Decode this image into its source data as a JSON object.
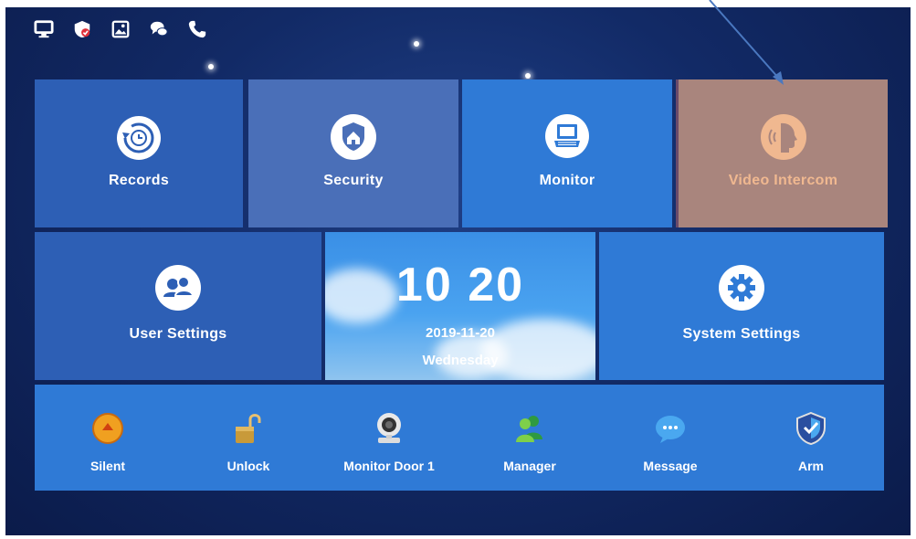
{
  "status_icons": [
    {
      "name": "display-icon"
    },
    {
      "name": "shield-alert-icon"
    },
    {
      "name": "picture-icon"
    },
    {
      "name": "chat-icon"
    },
    {
      "name": "phone-icon"
    }
  ],
  "tiles": {
    "records": {
      "label": "Records",
      "icon": "records-icon"
    },
    "security": {
      "label": "Security",
      "icon": "home-shield-icon"
    },
    "monitor": {
      "label": "Monitor",
      "icon": "monitor-icon"
    },
    "video_intercom": {
      "label": "Video Intercom",
      "icon": "speaking-head-icon"
    },
    "user_settings": {
      "label": "User Settings",
      "icon": "users-icon"
    },
    "system_settings": {
      "label": "System Settings",
      "icon": "gear-icon"
    }
  },
  "clock": {
    "hours": "10",
    "minutes": "20",
    "date": "2019-11-20",
    "day": "Wednesday"
  },
  "dock": [
    {
      "label": "Silent",
      "icon": "silent-icon"
    },
    {
      "label": "Unlock",
      "icon": "padlock-open-icon"
    },
    {
      "label": "Monitor Door 1",
      "icon": "camera-icon"
    },
    {
      "label": "Manager",
      "icon": "manager-icon"
    },
    {
      "label": "Message",
      "icon": "message-bubble-icon"
    },
    {
      "label": "Arm",
      "icon": "arm-shield-icon"
    }
  ],
  "colors": {
    "highlight_tile": "#a9857d",
    "arrow": "#4a78c0"
  }
}
